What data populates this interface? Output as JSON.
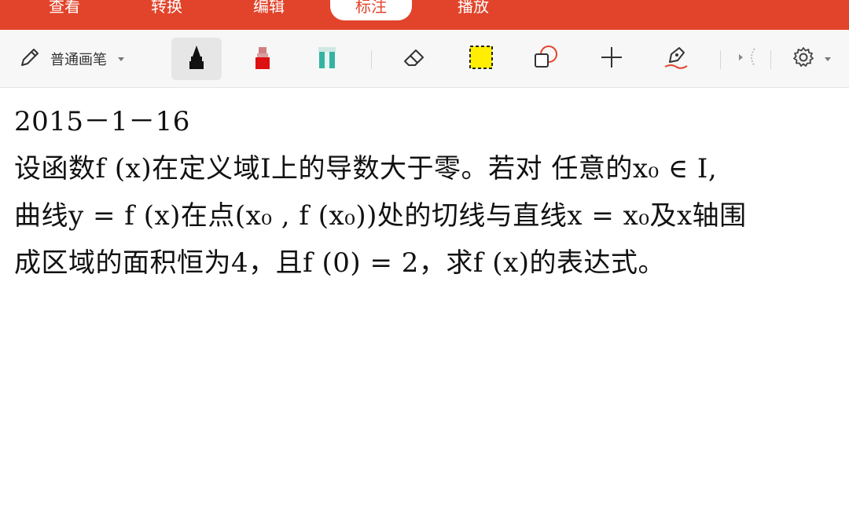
{
  "ribbon": {
    "tabs": [
      {
        "label": "查看"
      },
      {
        "label": "转换"
      },
      {
        "label": "编辑"
      },
      {
        "label": "标注",
        "active": true
      },
      {
        "label": "播放"
      }
    ],
    "accent_color": "#e2442b"
  },
  "toolbar": {
    "pen_type_label": "普通画笔",
    "tools": [
      {
        "icon": "pencil-icon"
      },
      {
        "icon": "black-marker-icon",
        "selected": true
      },
      {
        "icon": "red-marker-icon"
      },
      {
        "icon": "highlighter-icon"
      },
      {
        "icon": "eraser-icon"
      },
      {
        "icon": "rectangle-select-icon"
      },
      {
        "icon": "shape-icon"
      },
      {
        "icon": "plus-icon"
      },
      {
        "icon": "pen-sign-icon"
      },
      {
        "icon": "laser-pointer-icon"
      },
      {
        "icon": "settings-icon"
      }
    ]
  },
  "document": {
    "line1": "2015－1－16",
    "line2": "设函数f (x)在定义域I上的导数大于零。若对 任意的x₀ ∈ I,",
    "line3": "曲线y = f (x)在点(x₀ , f (x₀))处的切线与直线x = x₀及x轴围",
    "line4": "成区域的面积恒为4，且f (0) = 2，求f (x)的表达式。"
  }
}
